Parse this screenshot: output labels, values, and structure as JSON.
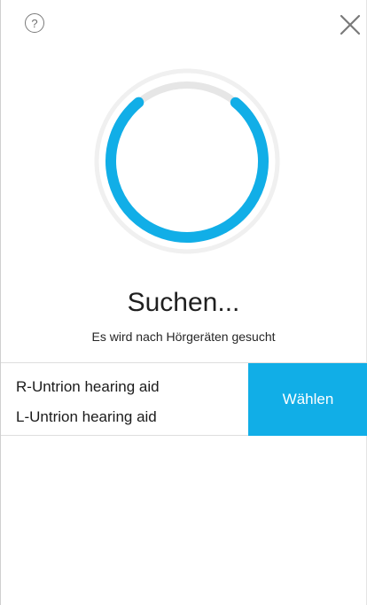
{
  "header": {
    "help_label": "?",
    "help_icon": "help-icon",
    "close_icon": "close-icon"
  },
  "progress": {
    "icon": "progress-ring",
    "accent_color": "#11aee7",
    "track_color": "#e6e6e6",
    "fraction": 0.78
  },
  "status": {
    "title": "Suchen...",
    "subtitle": "Es wird nach Hörgeräten gesucht"
  },
  "devices": [
    "R-Untrion hearing aid",
    "L-Untrion hearing aid"
  ],
  "actions": {
    "choose_label": "Wählen"
  }
}
